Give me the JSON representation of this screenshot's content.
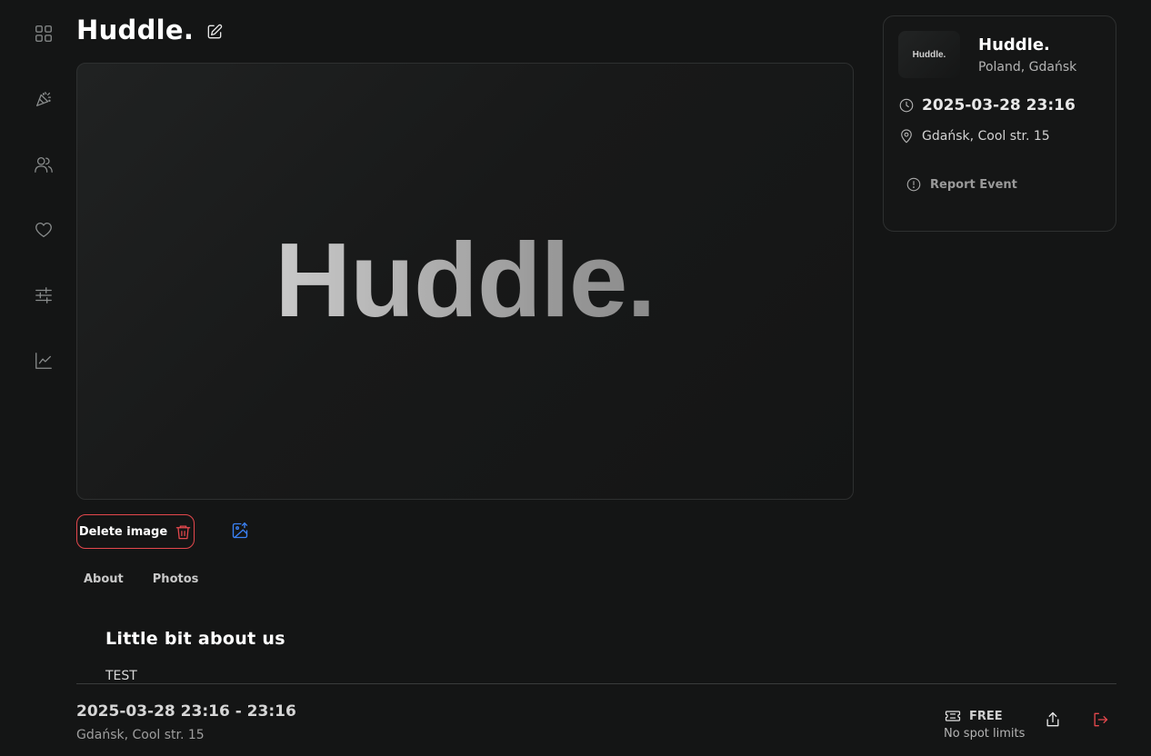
{
  "header": {
    "title": "Huddle."
  },
  "sidebar": {
    "items": [
      {
        "icon": "dashboard-icon"
      },
      {
        "icon": "party-popper-icon"
      },
      {
        "icon": "users-icon"
      },
      {
        "icon": "heart-icon"
      },
      {
        "icon": "sliders-icon"
      },
      {
        "icon": "chart-icon"
      }
    ]
  },
  "hero": {
    "logo_text": "Huddle."
  },
  "actions": {
    "delete_label": "Delete image"
  },
  "tabs": [
    "About",
    "Photos"
  ],
  "about": {
    "heading": "Little bit about us",
    "text": "TEST"
  },
  "card": {
    "thumb_text": "Huddle.",
    "name": "Huddle.",
    "location": "Poland, Gdańsk",
    "datetime": "2025-03-28 23:16",
    "address": "Gdańsk, Cool str. 15",
    "report_label": "Report Event"
  },
  "footer": {
    "time_range": "2025-03-28 23:16 - 23:16",
    "address": "Gdańsk, Cool str. 15",
    "price": "FREE",
    "spots": "No spot limits"
  },
  "colors": {
    "background": "#141515",
    "danger": "#e5484d",
    "accent": "#3b82f6"
  }
}
